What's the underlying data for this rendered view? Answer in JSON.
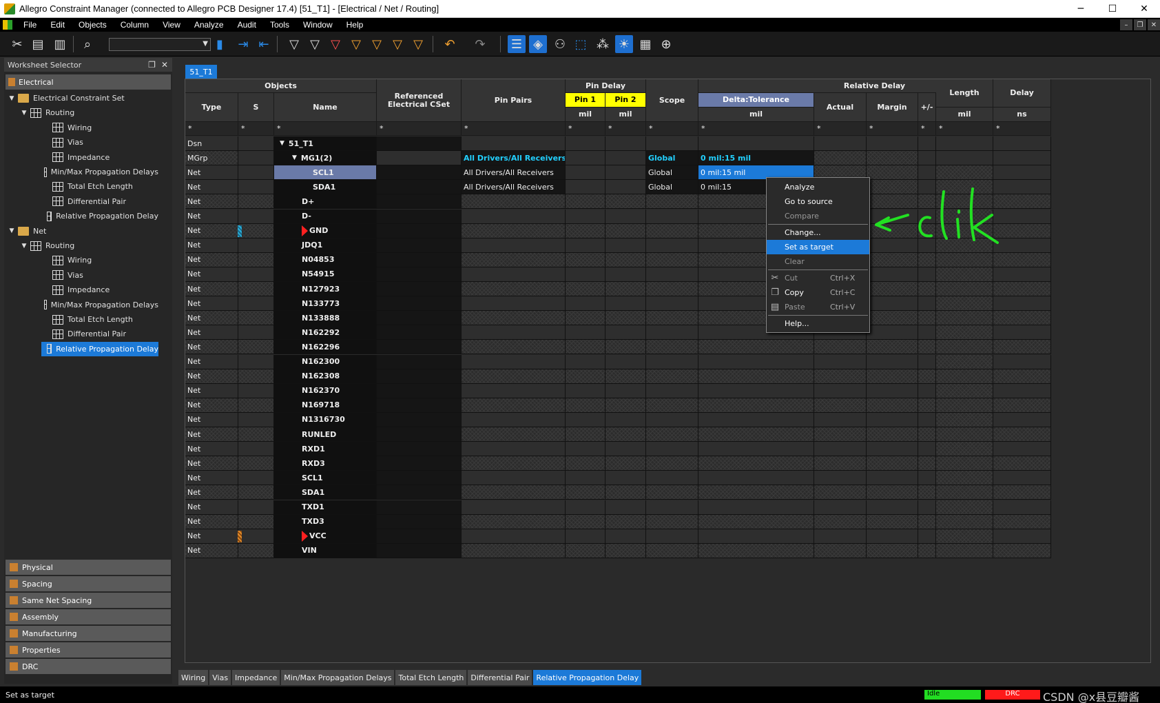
{
  "window": {
    "title": "Allegro Constraint Manager (connected to Allegro PCB Designer 17.4) [51_T1] - [Electrical / Net / Routing]",
    "minimize": "─",
    "maximize": "☐",
    "close": "✕"
  },
  "menu": [
    "File",
    "Edit",
    "Objects",
    "Column",
    "View",
    "Analyze",
    "Audit",
    "Tools",
    "Window",
    "Help"
  ],
  "mdi_controls": [
    "–",
    "❐",
    "✕"
  ],
  "worksheet": {
    "header": "Worksheet Selector",
    "pin": "❐",
    "close": "✕",
    "top_section": "Electrical",
    "tree": [
      {
        "label": "Electrical Constraint Set",
        "level": 0,
        "type": "folder",
        "twisty": "▼"
      },
      {
        "label": "Routing",
        "level": 1,
        "type": "sheetset",
        "twisty": "▼"
      },
      {
        "label": "Wiring",
        "level": 2,
        "type": "sheet"
      },
      {
        "label": "Vias",
        "level": 2,
        "type": "sheet"
      },
      {
        "label": "Impedance",
        "level": 2,
        "type": "sheet"
      },
      {
        "label": "Min/Max Propagation Delays",
        "level": 2,
        "type": "sheet"
      },
      {
        "label": "Total Etch Length",
        "level": 2,
        "type": "sheet"
      },
      {
        "label": "Differential Pair",
        "level": 2,
        "type": "sheet"
      },
      {
        "label": "Relative Propagation Delay",
        "level": 2,
        "type": "sheet"
      },
      {
        "label": "Net",
        "level": 0,
        "type": "folder",
        "twisty": "▼"
      },
      {
        "label": "Routing",
        "level": 1,
        "type": "sheetset",
        "twisty": "▼"
      },
      {
        "label": "Wiring",
        "level": 2,
        "type": "sheet"
      },
      {
        "label": "Vias",
        "level": 2,
        "type": "sheet"
      },
      {
        "label": "Impedance",
        "level": 2,
        "type": "sheet"
      },
      {
        "label": "Min/Max Propagation Delays",
        "level": 2,
        "type": "sheet"
      },
      {
        "label": "Total Etch Length",
        "level": 2,
        "type": "sheet"
      },
      {
        "label": "Differential Pair",
        "level": 2,
        "type": "sheet"
      },
      {
        "label": "Relative Propagation Delay",
        "level": 2,
        "type": "sheet",
        "selected": true
      }
    ],
    "bottom_sections": [
      "Physical",
      "Spacing",
      "Same Net Spacing",
      "Assembly",
      "Manufacturing",
      "Properties",
      "DRC"
    ]
  },
  "doc_tab": "51_T1",
  "grid": {
    "group_headers": {
      "objects": "Objects",
      "pin_delay": "Pin Delay",
      "relative_delay": "Relative Delay"
    },
    "headers": {
      "type": "Type",
      "s": "S",
      "name": "Name",
      "ref_cset": "Referenced Electrical CSet",
      "pin_pairs": "Pin Pairs",
      "pin1": "Pin 1",
      "pin2": "Pin 2",
      "scope": "Scope",
      "delta_tol": "Delta:Tolerance",
      "actual": "Actual",
      "margin": "Margin",
      "plusminus": "+/-",
      "length": "Length",
      "delay": "Delay"
    },
    "units": {
      "pin1": "mil",
      "pin2": "mil",
      "delta_tol": "mil",
      "length": "mil",
      "delay": "ns"
    },
    "filter": "*",
    "rows": [
      {
        "type": "Dsn",
        "name": "51_T1",
        "twisty": "▼",
        "indent": 1
      },
      {
        "type": "MGrp",
        "name": "MG1(2)",
        "twisty": "▼",
        "indent": 2,
        "pin_pairs": "All Drivers/All Receivers",
        "scope": "Global",
        "delta": "0 mil:15 mil"
      },
      {
        "type": "Net",
        "name": "SCL1",
        "indent": 3,
        "selected": true,
        "pin_pairs": "All Drivers/All Receivers",
        "scope": "Global",
        "delta": "0 mil:15 mil"
      },
      {
        "type": "Net",
        "name": "SDA1",
        "indent": 3,
        "pin_pairs": "All Drivers/All Receivers",
        "scope": "Global",
        "delta": "0 mil:15"
      },
      {
        "type": "Net",
        "name": "D+"
      },
      {
        "type": "Net",
        "name": "D-"
      },
      {
        "type": "Net",
        "name": "GND",
        "flag": true,
        "sbar": "cyan"
      },
      {
        "type": "Net",
        "name": "JDQ1"
      },
      {
        "type": "Net",
        "name": "N04853"
      },
      {
        "type": "Net",
        "name": "N54915"
      },
      {
        "type": "Net",
        "name": "N127923"
      },
      {
        "type": "Net",
        "name": "N133773"
      },
      {
        "type": "Net",
        "name": "N133888"
      },
      {
        "type": "Net",
        "name": "N162292"
      },
      {
        "type": "Net",
        "name": "N162296"
      },
      {
        "type": "Net",
        "name": "N162300"
      },
      {
        "type": "Net",
        "name": "N162308"
      },
      {
        "type": "Net",
        "name": "N162370"
      },
      {
        "type": "Net",
        "name": "N169718"
      },
      {
        "type": "Net",
        "name": "N1316730"
      },
      {
        "type": "Net",
        "name": "RUNLED"
      },
      {
        "type": "Net",
        "name": "RXD1"
      },
      {
        "type": "Net",
        "name": "RXD3"
      },
      {
        "type": "Net",
        "name": "SCL1"
      },
      {
        "type": "Net",
        "name": "SDA1"
      },
      {
        "type": "Net",
        "name": "TXD1"
      },
      {
        "type": "Net",
        "name": "TXD3"
      },
      {
        "type": "Net",
        "name": "VCC",
        "flag": true,
        "sbar": "orange"
      },
      {
        "type": "Net",
        "name": "VIN"
      }
    ]
  },
  "context_menu": {
    "items": [
      {
        "label": "Analyze",
        "enabled": true
      },
      {
        "label": "Go to source",
        "enabled": true
      },
      {
        "label": "Compare",
        "enabled": false
      },
      {
        "sep": true
      },
      {
        "label": "Change...",
        "enabled": true
      },
      {
        "label": "Set as target",
        "enabled": true,
        "selected": true
      },
      {
        "label": "Clear",
        "enabled": false
      },
      {
        "sep": true
      },
      {
        "label": "Cut",
        "shortcut": "Ctrl+X",
        "enabled": false,
        "icon": "scissors-icon"
      },
      {
        "label": "Copy",
        "shortcut": "Ctrl+C",
        "enabled": true,
        "icon": "copy-icon"
      },
      {
        "label": "Paste",
        "shortcut": "Ctrl+V",
        "enabled": false,
        "icon": "paste-icon"
      },
      {
        "sep": true
      },
      {
        "label": "Help...",
        "enabled": true
      }
    ]
  },
  "annotation": {
    "text": "click",
    "color": "#22e022"
  },
  "bottom_tabs": [
    {
      "label": "Wiring"
    },
    {
      "label": "Vias"
    },
    {
      "label": "Impedance"
    },
    {
      "label": "Min/Max Propagation Delays"
    },
    {
      "label": "Total Etch Length"
    },
    {
      "label": "Differential Pair"
    },
    {
      "label": "Relative Propagation Delay",
      "selected": true
    }
  ],
  "status": {
    "message": "Set as target",
    "idle": "Idle",
    "drc": "DRC",
    "watermark": "CSDN @x县豆瓣酱"
  }
}
